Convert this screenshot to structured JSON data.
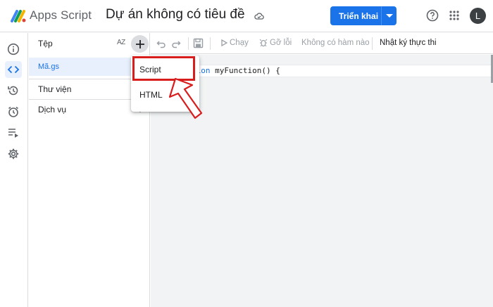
{
  "header": {
    "app_name": "Apps Script",
    "project_title": "Dự án không có tiêu đề",
    "deploy_label": "Triển khai",
    "avatar_letter": "L"
  },
  "files": {
    "title": "Tệp",
    "sort_label": "AZ",
    "items": [
      {
        "label": "Mã.gs"
      }
    ],
    "sections": [
      {
        "label": "Thư viện"
      },
      {
        "label": "Dịch vụ"
      }
    ]
  },
  "toolbar": {
    "run_label": "Chạy",
    "debug_label": "Gỡ lỗi",
    "function_select": "Không có hàm nào",
    "exec_log_label": "Nhật ký thực thi"
  },
  "editor": {
    "code_keyword": "tion",
    "code_rest": " myFunction() {"
  },
  "menu": {
    "items": [
      {
        "label": "Script"
      },
      {
        "label": "HTML"
      }
    ]
  },
  "colors": {
    "accent": "#1a73e8",
    "highlight": "#d81d1d"
  }
}
